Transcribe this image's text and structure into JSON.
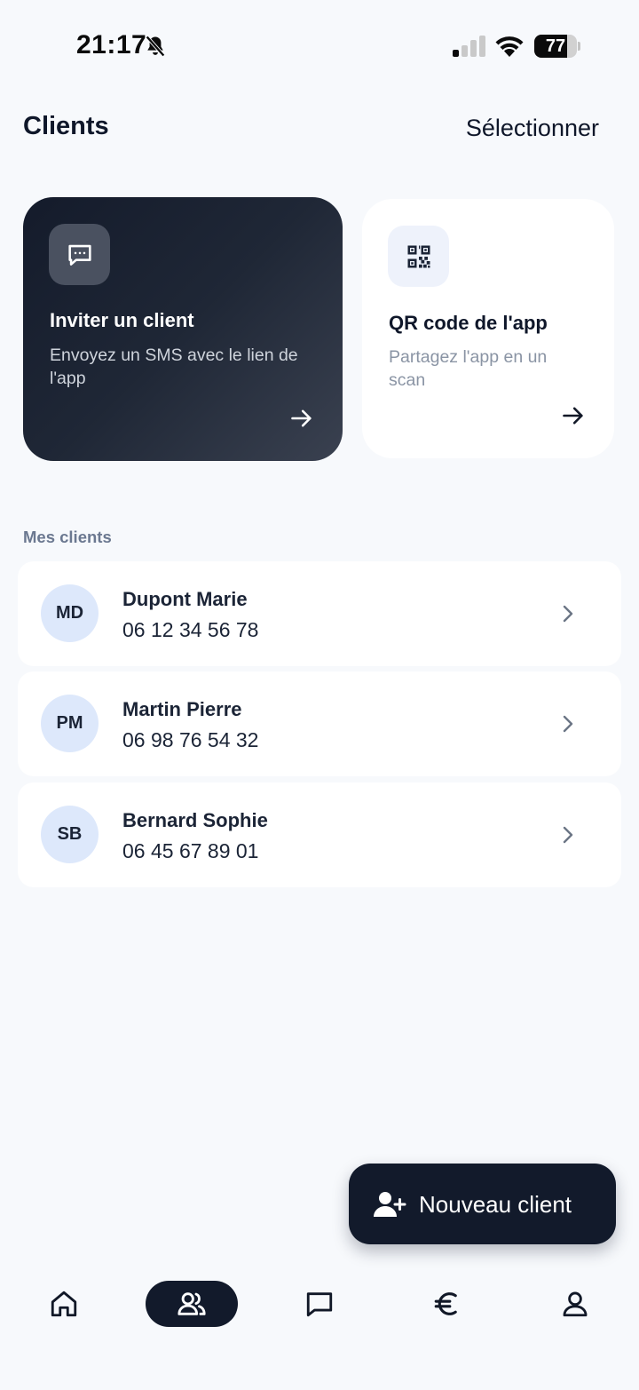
{
  "status_bar": {
    "time": "21:17",
    "battery": "77",
    "battery_level": 0.77
  },
  "header": {
    "title": "Clients",
    "select_label": "Sélectionner"
  },
  "actions": {
    "invite": {
      "title": "Inviter un client",
      "description": "Envoyez un SMS avec le lien de l'app",
      "icon": "message-dots-icon"
    },
    "qr": {
      "title": "QR code de l'app",
      "description": "Partagez l'app en un scan",
      "icon": "qr-code-icon"
    }
  },
  "clients": {
    "section_label": "Mes clients",
    "items": [
      {
        "initials": "MD",
        "name": "Dupont Marie",
        "phone": "06 12 34 56 78"
      },
      {
        "initials": "PM",
        "name": "Martin Pierre",
        "phone": "06 98 76 54 32"
      },
      {
        "initials": "SB",
        "name": "Bernard Sophie",
        "phone": "06 45 67 89 01"
      }
    ]
  },
  "fab": {
    "label": "Nouveau client",
    "icon": "user-plus-icon"
  },
  "nav": {
    "items": [
      {
        "icon": "home-icon",
        "active": false
      },
      {
        "icon": "users-icon",
        "active": true
      },
      {
        "icon": "chat-icon",
        "active": false
      },
      {
        "icon": "euro-icon",
        "active": false
      },
      {
        "icon": "profile-icon",
        "active": false
      }
    ]
  },
  "colors": {
    "background": "#f7f9fc",
    "dark": "#121a2b",
    "avatar_bg": "#dde8fb",
    "muted_text": "#6b7890"
  }
}
